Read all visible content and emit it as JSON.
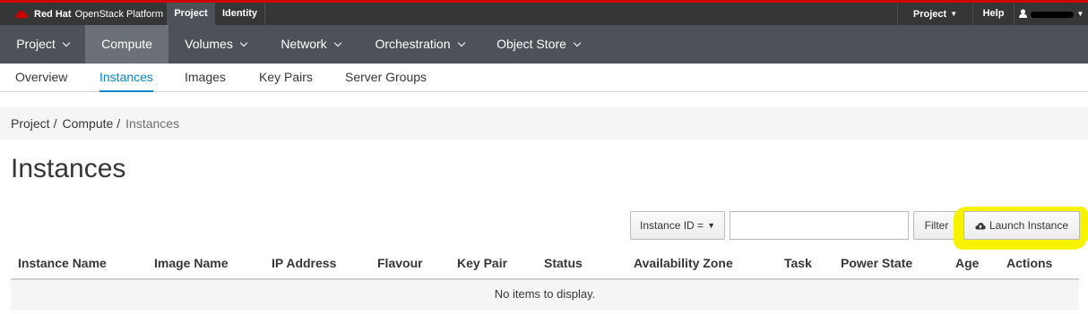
{
  "brand": {
    "name_bold": "Red Hat",
    "name_rest": "OpenStack Platform"
  },
  "top_tabs": {
    "project": "Project",
    "identity": "Identity"
  },
  "top_right": {
    "project_menu": "Project",
    "help": "Help"
  },
  "primary_nav": [
    "Project",
    "Compute",
    "Volumes",
    "Network",
    "Orchestration",
    "Object Store"
  ],
  "secondary_nav": [
    "Overview",
    "Instances",
    "Images",
    "Key Pairs",
    "Server Groups"
  ],
  "breadcrumb": [
    "Project",
    "Compute",
    "Instances"
  ],
  "page_title": "Instances",
  "toolbar": {
    "filter_field_label": "Instance ID =",
    "filter_input_value": "",
    "filter_button": "Filter",
    "launch_button": "Launch Instance"
  },
  "table": {
    "columns": [
      "Instance Name",
      "Image Name",
      "IP Address",
      "Flavour",
      "Key Pair",
      "Status",
      "Availability Zone",
      "Task",
      "Power State",
      "Age",
      "Actions"
    ],
    "empty_message": "No items to display."
  },
  "colors": {
    "accent_top": "#cc0000",
    "active_link": "#0088ce",
    "highlight": "#f7f200"
  }
}
